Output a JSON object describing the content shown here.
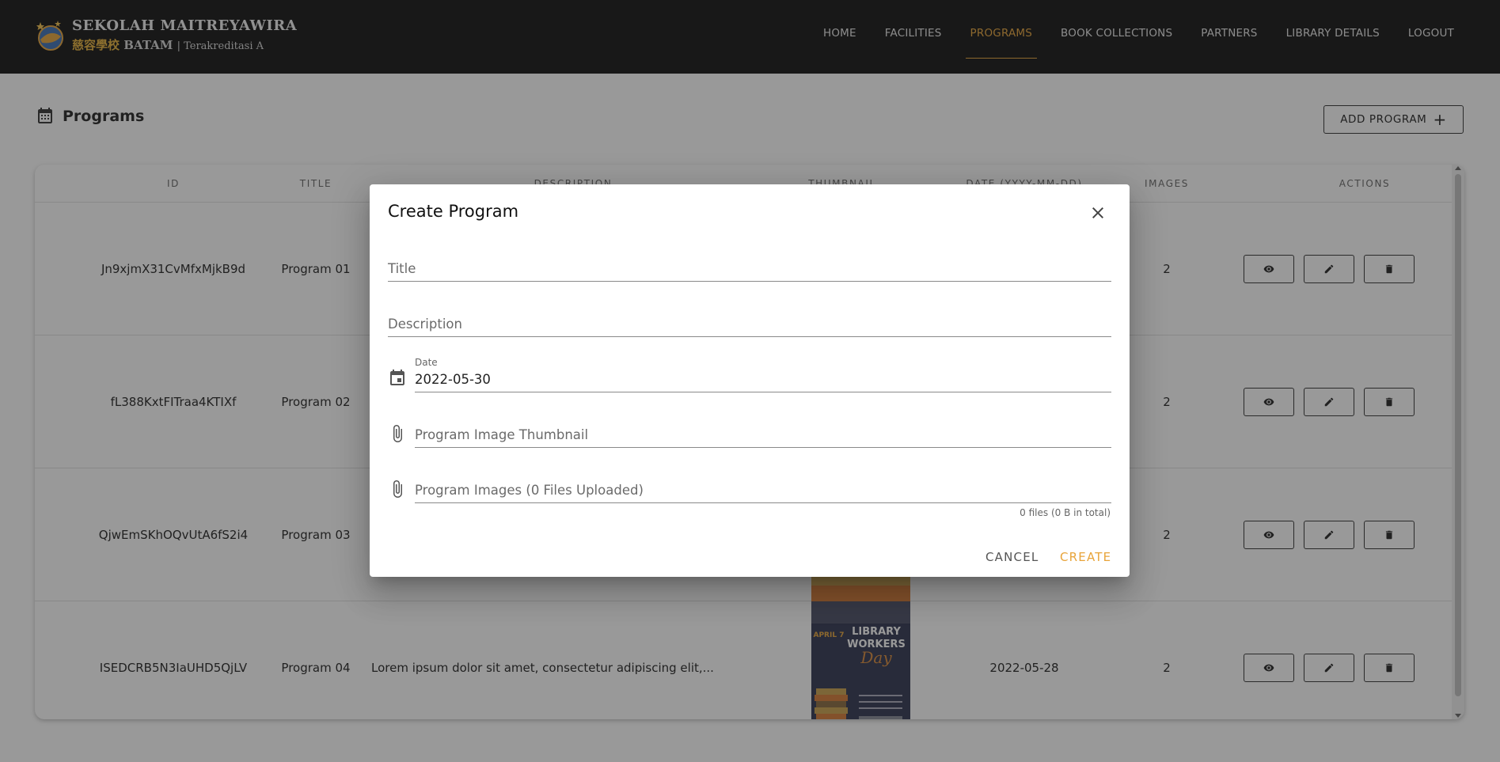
{
  "header": {
    "logo_line1": "SEKOLAH MAITREYAWIRA",
    "logo_chinese": "慈容學校",
    "logo_city": "BATAM",
    "logo_accreditation": "| Terakreditasi A",
    "nav": [
      {
        "label": "HOME",
        "active": false
      },
      {
        "label": "FACILITIES",
        "active": false
      },
      {
        "label": "PROGRAMS",
        "active": true
      },
      {
        "label": "BOOK COLLECTIONS",
        "active": false
      },
      {
        "label": "PARTNERS",
        "active": false
      },
      {
        "label": "LIBRARY DETAILS",
        "active": false
      },
      {
        "label": "LOGOUT",
        "active": false
      }
    ]
  },
  "page": {
    "title": "Programs",
    "add_button_label": "ADD PROGRAM",
    "title_icon": "calendar-icon"
  },
  "table": {
    "columns": [
      "ID",
      "TITLE",
      "DESCRIPTION",
      "THUMBNAIL",
      "DATE (YYYY-MM-DD)",
      "IMAGES",
      "ACTIONS"
    ],
    "rows": [
      {
        "id": "Jn9xjmX31CvMfxMjkB9d",
        "title": "Program 01",
        "description": "",
        "date": "",
        "images": "2"
      },
      {
        "id": "fL388KxtFITraa4KTIXf",
        "title": "Program 02",
        "description": "",
        "date": "",
        "images": "2"
      },
      {
        "id": "QjwEmSKhOQvUtA6fS2i4",
        "title": "Program 03",
        "description": "",
        "date": "",
        "images": "2"
      },
      {
        "id": "ISEDCRB5N3IaUHD5QjLV",
        "title": "Program 04",
        "description": "Lorem ipsum dolor sit amet, consectetur adipiscing elit,...",
        "date": "2022-05-28",
        "images": "2"
      }
    ],
    "thumbnail_text": {
      "line1": "LIBRARY",
      "line2": "WORKERS",
      "line3": "Day",
      "side": "APRIL 7"
    },
    "action_icons": [
      "eye-icon",
      "pencil-icon",
      "trash-icon"
    ]
  },
  "dialog": {
    "title": "Create Program",
    "fields": {
      "title_placeholder": "Title",
      "description_placeholder": "Description",
      "date_label": "Date",
      "date_value": "2022-05-30",
      "thumbnail_placeholder": "Program Image Thumbnail",
      "images_placeholder": "Program Images (0 Files Uploaded)"
    },
    "files_hint": "0 files (0 B in total)",
    "cancel_label": "CANCEL",
    "create_label": "CREATE"
  },
  "colors": {
    "accent": "#e8a43a",
    "header_bg": "#121212",
    "overlay": "rgba(33,33,33,0.46)"
  }
}
